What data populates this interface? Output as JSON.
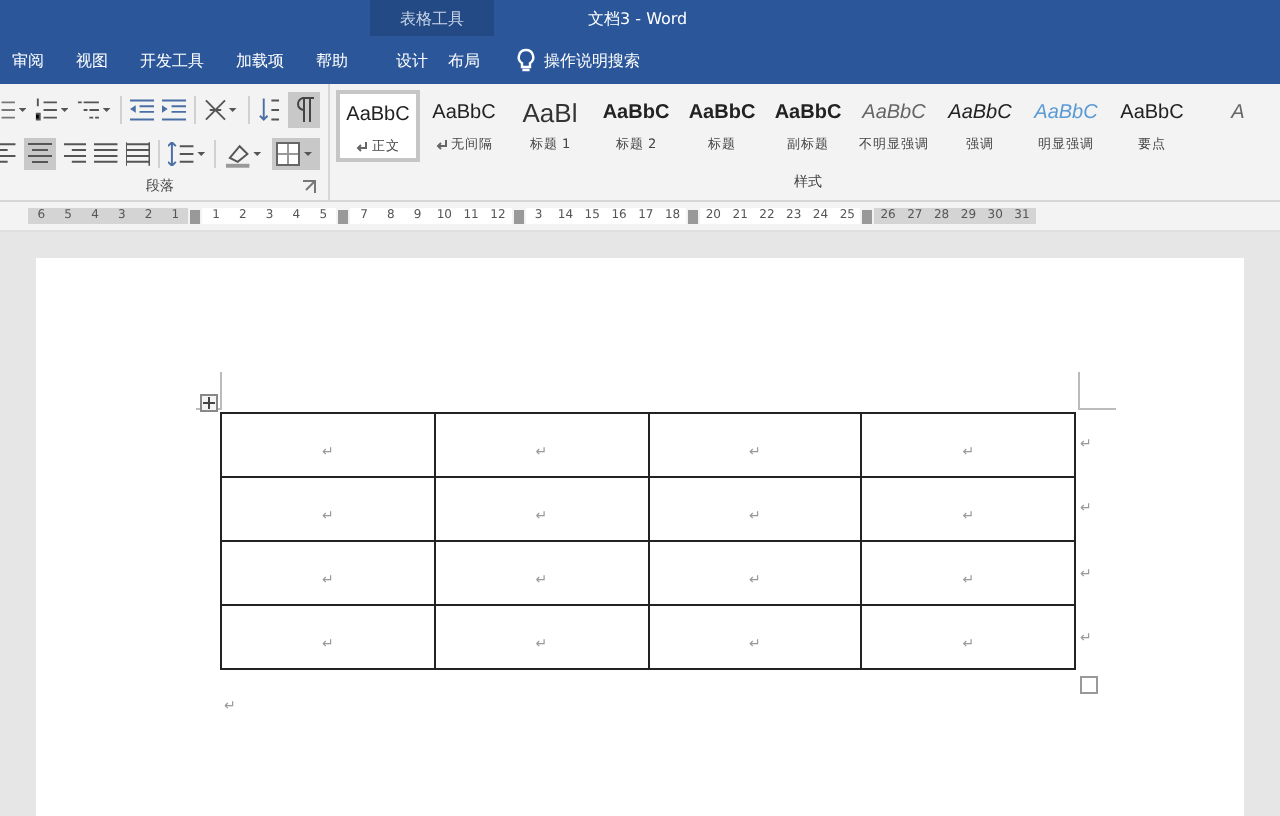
{
  "window": {
    "title": "文档3 - Word",
    "context_label": "表格工具"
  },
  "tabs": [
    {
      "label": "审阅",
      "selected": false,
      "contextual": false
    },
    {
      "label": "视图",
      "selected": false,
      "contextual": false
    },
    {
      "label": "开发工具",
      "selected": false,
      "contextual": false
    },
    {
      "label": "加载项",
      "selected": false,
      "contextual": false
    },
    {
      "label": "帮助",
      "selected": false,
      "contextual": false
    },
    {
      "label": "设计",
      "selected": false,
      "contextual": true
    },
    {
      "label": "布局",
      "selected": false,
      "contextual": true
    }
  ],
  "search": {
    "placeholder": "操作说明搜索"
  },
  "paragraph_group": {
    "label": "段落"
  },
  "styles_group": {
    "label": "样式"
  },
  "styles": [
    {
      "sample": "AaBbC",
      "label": "正文",
      "kind": "normal",
      "mark": true,
      "selected": true
    },
    {
      "sample": "AaBbC",
      "label": "无间隔",
      "kind": "normal",
      "mark": true,
      "selected": false
    },
    {
      "sample": "AaBl",
      "label": "标题 1",
      "kind": "large",
      "mark": false,
      "selected": false
    },
    {
      "sample": "AaBbC",
      "label": "标题 2",
      "kind": "bold",
      "mark": false,
      "selected": false
    },
    {
      "sample": "AaBbC",
      "label": "标题",
      "kind": "bold",
      "mark": false,
      "selected": false
    },
    {
      "sample": "AaBbC",
      "label": "副标题",
      "kind": "bold",
      "mark": false,
      "selected": false
    },
    {
      "sample": "AaBbC",
      "label": "不明显强调",
      "kind": "subtle",
      "mark": false,
      "selected": false
    },
    {
      "sample": "AaBbC",
      "label": "强调",
      "kind": "italic",
      "mark": false,
      "selected": false
    },
    {
      "sample": "AaBbC",
      "label": "明显强调",
      "kind": "intense",
      "mark": false,
      "selected": false
    },
    {
      "sample": "AaBbC",
      "label": "要点",
      "kind": "normal",
      "mark": false,
      "selected": false
    },
    {
      "sample": "A",
      "kind": "subtle",
      "selected": false
    }
  ],
  "ruler": [
    {
      "kind": "number",
      "label": "6",
      "shaded": true
    },
    {
      "kind": "number",
      "label": "5",
      "shaded": true
    },
    {
      "kind": "number",
      "label": "4",
      "shaded": true
    },
    {
      "kind": "number",
      "label": "3",
      "shaded": true
    },
    {
      "kind": "number",
      "label": "2",
      "shaded": true
    },
    {
      "kind": "number",
      "label": "1",
      "shaded": true
    },
    {
      "kind": "marker"
    },
    {
      "kind": "number",
      "label": "1",
      "shaded": false
    },
    {
      "kind": "number",
      "label": "2",
      "shaded": false
    },
    {
      "kind": "number",
      "label": "3",
      "shaded": false
    },
    {
      "kind": "number",
      "label": "4",
      "shaded": false
    },
    {
      "kind": "number",
      "label": "5",
      "shaded": false
    },
    {
      "kind": "marker"
    },
    {
      "kind": "number",
      "label": "7",
      "shaded": false
    },
    {
      "kind": "number",
      "label": "8",
      "shaded": false
    },
    {
      "kind": "number",
      "label": "9",
      "shaded": false
    },
    {
      "kind": "number",
      "label": "10",
      "shaded": false
    },
    {
      "kind": "number",
      "label": "11",
      "shaded": false
    },
    {
      "kind": "number",
      "label": "12",
      "shaded": false
    },
    {
      "kind": "marker"
    },
    {
      "kind": "number",
      "label": "3",
      "shaded": false
    },
    {
      "kind": "number",
      "label": "14",
      "shaded": false
    },
    {
      "kind": "number",
      "label": "15",
      "shaded": false
    },
    {
      "kind": "number",
      "label": "16",
      "shaded": false
    },
    {
      "kind": "number",
      "label": "17",
      "shaded": false
    },
    {
      "kind": "number",
      "label": "18",
      "shaded": false
    },
    {
      "kind": "marker"
    },
    {
      "kind": "number",
      "label": "20",
      "shaded": false
    },
    {
      "kind": "number",
      "label": "21",
      "shaded": false
    },
    {
      "kind": "number",
      "label": "22",
      "shaded": false
    },
    {
      "kind": "number",
      "label": "23",
      "shaded": false
    },
    {
      "kind": "number",
      "label": "24",
      "shaded": false
    },
    {
      "kind": "number",
      "label": "25",
      "shaded": false
    },
    {
      "kind": "marker"
    },
    {
      "kind": "number",
      "label": "26",
      "shaded": true
    },
    {
      "kind": "number",
      "label": "27",
      "shaded": true
    },
    {
      "kind": "number",
      "label": "28",
      "shaded": true
    },
    {
      "kind": "number",
      "label": "29",
      "shaded": true
    },
    {
      "kind": "number",
      "label": "30",
      "shaded": true
    },
    {
      "kind": "number",
      "label": "31",
      "shaded": true
    }
  ],
  "table": {
    "rows": [
      {
        "cells": [
          "↵",
          "↵",
          "↵",
          "↵"
        ],
        "end_mark": "↵"
      },
      {
        "cells": [
          "↵",
          "↵",
          "↵",
          "↵"
        ],
        "end_mark": "↵"
      },
      {
        "cells": [
          "↵",
          "↵",
          "↵",
          "↵"
        ],
        "end_mark": "↵"
      },
      {
        "cells": [
          "↵",
          "↵",
          "↵",
          "↵"
        ],
        "end_mark": "↵"
      }
    ]
  },
  "paragraph_mark": "↵"
}
